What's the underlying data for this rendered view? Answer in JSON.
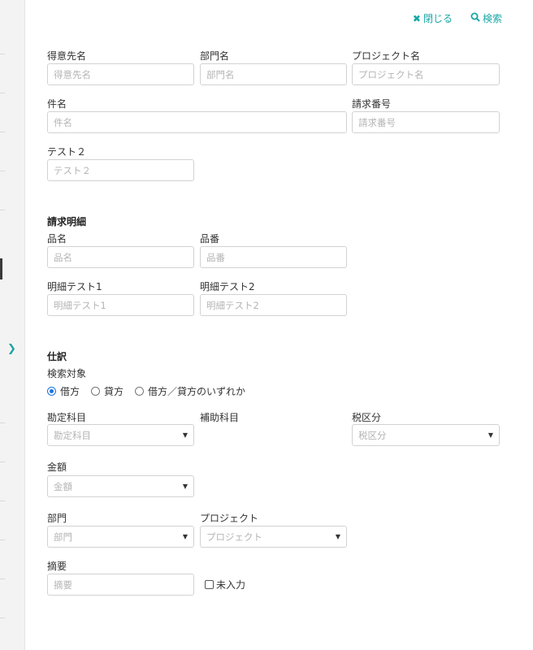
{
  "header": {
    "close_label": "閉じる",
    "search_label": "検索",
    "close_icon": "x-icon",
    "search_icon": "magnifier-icon",
    "accent_color": "#18a6a6"
  },
  "basic": {
    "customer": {
      "label": "得意先名",
      "placeholder": "得意先名"
    },
    "department": {
      "label": "部門名",
      "placeholder": "部門名"
    },
    "project": {
      "label": "プロジェクト名",
      "placeholder": "プロジェクト名"
    },
    "subject": {
      "label": "件名",
      "placeholder": "件名"
    },
    "invoice_no": {
      "label": "請求番号",
      "placeholder": "請求番号"
    },
    "test2": {
      "label": "テスト２",
      "placeholder": "テスト２"
    }
  },
  "detail": {
    "title": "請求明細",
    "item_name": {
      "label": "品名",
      "placeholder": "品名"
    },
    "item_no": {
      "label": "品番",
      "placeholder": "品番"
    },
    "detail_test1": {
      "label": "明細テスト1",
      "placeholder": "明細テスト1"
    },
    "detail_test2": {
      "label": "明細テスト2",
      "placeholder": "明細テスト2"
    }
  },
  "journal": {
    "title": "仕訳",
    "target_label": "検索対象",
    "targets": [
      "借方",
      "貸方",
      "借方／貸方のいずれか"
    ],
    "selected_target": "借方",
    "account": {
      "label": "勘定科目",
      "placeholder": "勘定科目"
    },
    "sub_account_label": "補助科目",
    "tax": {
      "label": "税区分",
      "placeholder": "税区分"
    },
    "amount": {
      "label": "金額",
      "placeholder": "金額"
    },
    "dept": {
      "label": "部門",
      "placeholder": "部門"
    },
    "proj": {
      "label": "プロジェクト",
      "placeholder": "プロジェクト"
    },
    "memo": {
      "label": "摘要",
      "placeholder": "摘要"
    },
    "unentered_label": "未入力"
  },
  "sidebar": {
    "expand_icon": "chevron-right-icon"
  }
}
